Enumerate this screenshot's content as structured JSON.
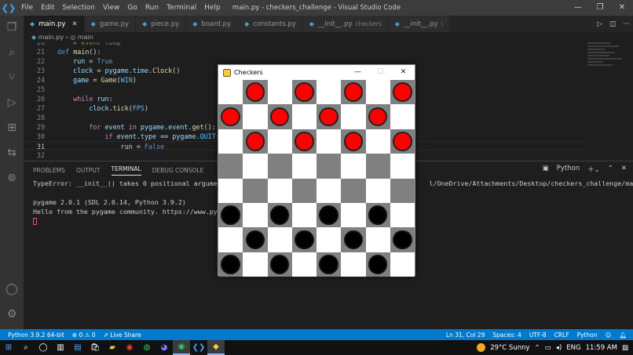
{
  "titlebar": {
    "menus": [
      "File",
      "Edit",
      "Selection",
      "View",
      "Go",
      "Run",
      "Terminal",
      "Help"
    ],
    "window_title": "main.py - checkers_challenge - Visual Studio Code"
  },
  "tabs": [
    {
      "label": "main.py",
      "active": true
    },
    {
      "label": "game.py",
      "active": false
    },
    {
      "label": "piece.py",
      "active": false
    },
    {
      "label": "board.py",
      "active": false
    },
    {
      "label": "constants.py",
      "active": false
    },
    {
      "label": "__init__.py",
      "desc": "checkers",
      "active": false
    },
    {
      "label": "__init__.py",
      "desc": "\\",
      "active": false
    }
  ],
  "breadcrumb": {
    "file": "main.py",
    "symbol": "main"
  },
  "editor": {
    "lines": [
      {
        "num": "20",
        "text": "# event loop"
      },
      {
        "num": "21",
        "text": "def main():"
      },
      {
        "num": "22",
        "text": "    run = True"
      },
      {
        "num": "23",
        "text": "    clock = pygame.time.Clock()"
      },
      {
        "num": "24",
        "text": "    game = Game(WIN)"
      },
      {
        "num": "25",
        "text": ""
      },
      {
        "num": "26",
        "text": "    while run:"
      },
      {
        "num": "27",
        "text": "        clock.tick(FPS)"
      },
      {
        "num": "28",
        "text": ""
      },
      {
        "num": "29",
        "text": "        for event in pygame.event.get():"
      },
      {
        "num": "30",
        "text": "            if event.type == pygame.QUIT:"
      },
      {
        "num": "31",
        "text": "                run = False"
      },
      {
        "num": "32",
        "text": ""
      }
    ]
  },
  "panel": {
    "tabs": [
      "PROBLEMS",
      "OUTPUT",
      "TERMINAL",
      "DEBUG CONSOLE"
    ],
    "active_tab": "TERMINAL",
    "shell": "Python",
    "terminal_lines": [
      "TypeError: __init__() takes 0 positional arguments but                                               l/OneDrive/Attachments/Desktop/checkers_challenge/main.py",
      "",
      "pygame 2.0.1 (SDL 2.0.14, Python 3.9.2)",
      "Hello from the pygame community. https://www.pygame"
    ]
  },
  "statusbar": {
    "interpreter": "Python 3.9.2 64-bit",
    "errors": "0",
    "warnings": "0",
    "live_share": "Live Share",
    "position": "Ln 31, Col 29",
    "spaces": "Spaces: 4",
    "encoding": "UTF-8",
    "eol": "CRLF",
    "language": "Python"
  },
  "taskbar": {
    "weather": "29°C  Sunny",
    "lang": "ENG",
    "time": "11:59 AM"
  },
  "game_window": {
    "title": "Checkers",
    "board": [
      [
        "",
        "R",
        "",
        "R",
        "",
        "R",
        "",
        "R"
      ],
      [
        "R",
        "",
        "R",
        "",
        "R",
        "",
        "R",
        ""
      ],
      [
        "",
        "R",
        "",
        "R",
        "",
        "R",
        "",
        "R"
      ],
      [
        "",
        "",
        "",
        "",
        "",
        "",
        "",
        ""
      ],
      [
        "",
        "",
        "",
        "",
        "",
        "",
        "",
        ""
      ],
      [
        "B",
        "",
        "B",
        "",
        "B",
        "",
        "B",
        ""
      ],
      [
        "",
        "B",
        "",
        "B",
        "",
        "B",
        "",
        "B"
      ],
      [
        "B",
        "",
        "B",
        "",
        "B",
        "",
        "B",
        ""
      ]
    ],
    "colors": {
      "red": "#ff0000",
      "black": "#000000",
      "dark_square": "#808080",
      "light_square": "#ffffff"
    }
  }
}
